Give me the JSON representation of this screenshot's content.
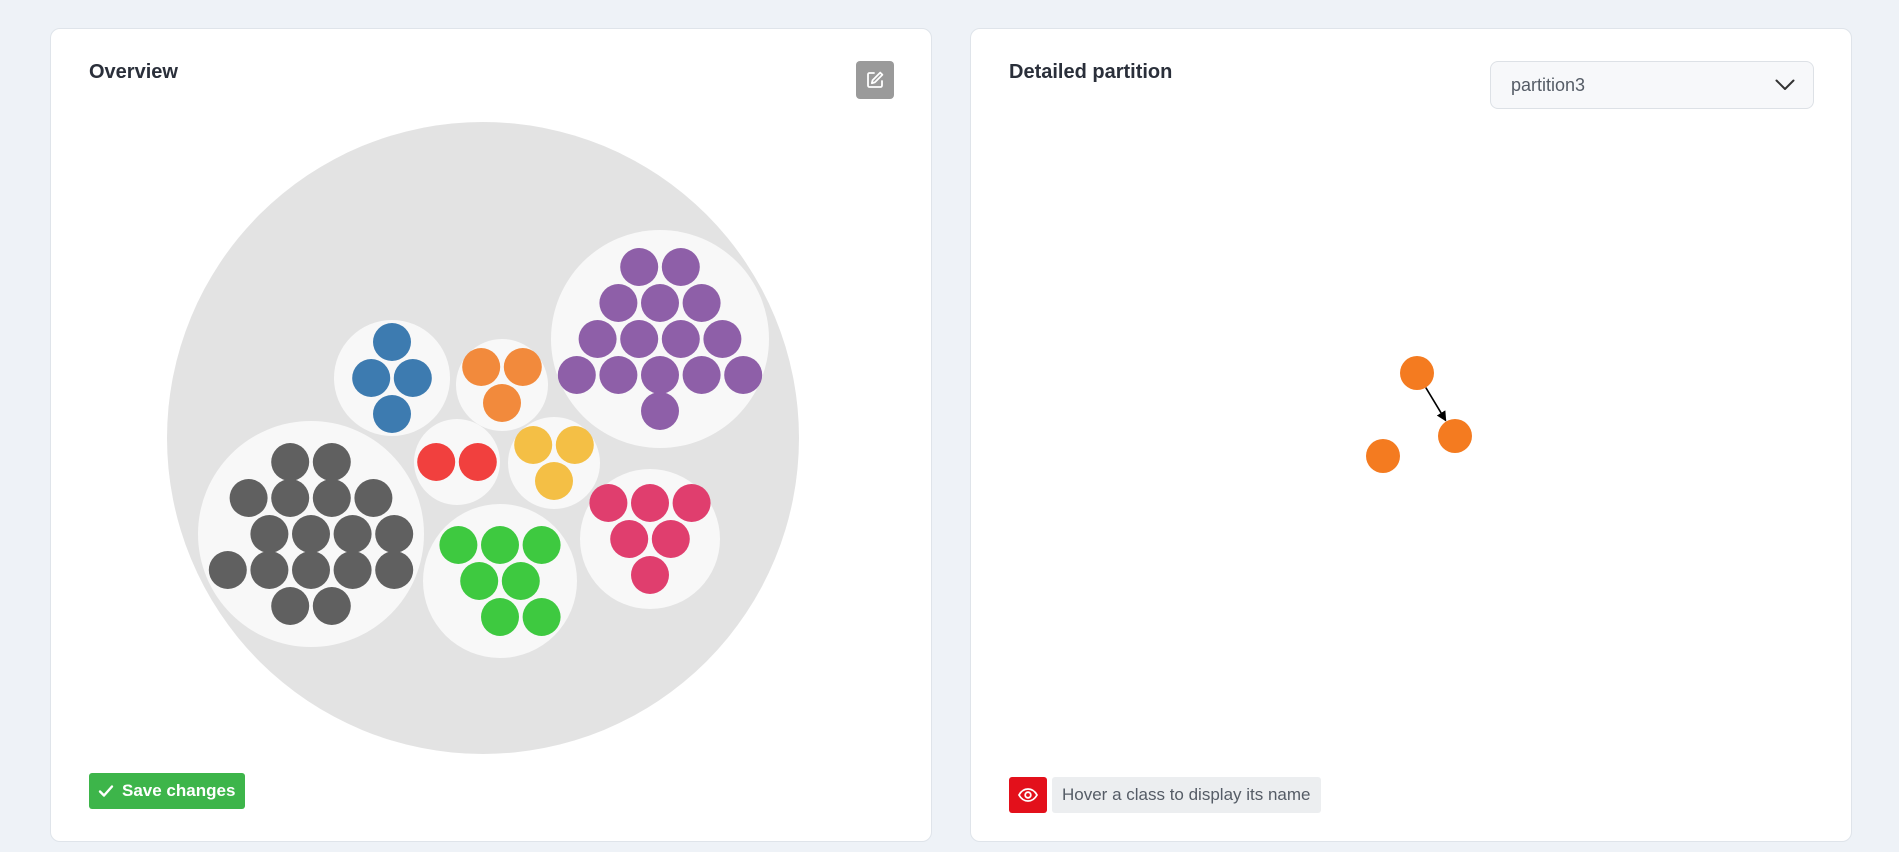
{
  "overview": {
    "title": "Overview",
    "save_label": "Save changes",
    "clusters": [
      {
        "id": "gray",
        "color": "#606060",
        "count": 18
      },
      {
        "id": "blue",
        "color": "#3d7bb0",
        "count": 4
      },
      {
        "id": "orange",
        "color": "#f28a3c",
        "count": 3
      },
      {
        "id": "purple",
        "color": "#8e5fa8",
        "count": 15
      },
      {
        "id": "red",
        "color": "#f1403e",
        "count": 2
      },
      {
        "id": "yellow",
        "color": "#f4bf45",
        "count": 3
      },
      {
        "id": "green",
        "color": "#3ec940",
        "count": 7
      },
      {
        "id": "pink",
        "color": "#e03e6e",
        "count": 6
      }
    ]
  },
  "detail": {
    "title": "Detailed partition",
    "selected_partition": "partition3",
    "hover_hint": "Hover a class to display its name",
    "node_color": "#f47b20",
    "node_count": 3,
    "edges": [
      [
        0,
        1
      ]
    ]
  }
}
